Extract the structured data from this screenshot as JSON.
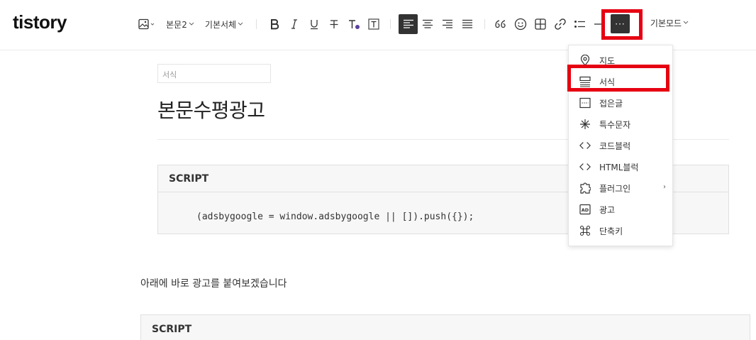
{
  "logo": "tistory",
  "toolbar": {
    "paragraph_style": "본문2",
    "font_family": "기본서체",
    "mode": "기본모드",
    "more_label": "···"
  },
  "editor": {
    "category_placeholder": "서식",
    "title": "본문수평광고",
    "paragraph": "아래에 바로 광고를 붙여보겠습니다"
  },
  "code_blocks": [
    {
      "header": "SCRIPT",
      "code": "(adsbygoogle = window.adsbygoogle || []).push({});"
    },
    {
      "header": "SCRIPT"
    }
  ],
  "menu": {
    "items": [
      {
        "label": "지도",
        "icon": "map-pin-icon"
      },
      {
        "label": "서식",
        "icon": "template-icon"
      },
      {
        "label": "접은글",
        "icon": "fold-icon"
      },
      {
        "label": "특수문자",
        "icon": "special-char-icon"
      },
      {
        "label": "코드블럭",
        "icon": "code-icon"
      },
      {
        "label": "HTML블럭",
        "icon": "html-icon"
      },
      {
        "label": "플러그인",
        "icon": "plugin-icon"
      },
      {
        "label": "광고",
        "icon": "ad-icon"
      },
      {
        "label": "단축키",
        "icon": "command-icon"
      }
    ],
    "plugin_arrow": "›"
  },
  "colors": {
    "highlight": "#e60012",
    "text_color_dot": "#5b3fa0",
    "active_button": "#333333"
  }
}
